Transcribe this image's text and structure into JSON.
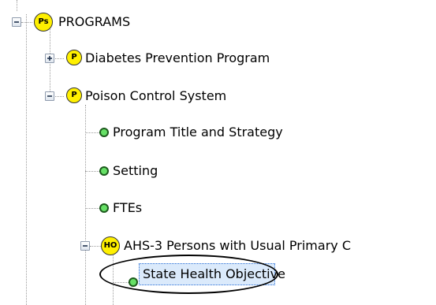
{
  "tree": {
    "nodes": [
      {
        "id": "programs",
        "label": "PROGRAMS",
        "badge": "Ps",
        "toggle": "collapse"
      },
      {
        "id": "diabetes-prevention-program",
        "label": "Diabetes Prevention Program",
        "badge": "P",
        "toggle": "expand"
      },
      {
        "id": "poison-control-system",
        "label": "Poison Control System",
        "badge": "P",
        "toggle": "collapse"
      },
      {
        "id": "program-title-and-strategy",
        "label": "Program Title and Strategy",
        "icon": "green-circle-icon"
      },
      {
        "id": "setting",
        "label": "Setting",
        "icon": "green-circle-icon"
      },
      {
        "id": "ftes",
        "label": "FTEs",
        "icon": "green-circle-icon"
      },
      {
        "id": "ahs-3",
        "label": "AHS-3 Persons with Usual Primary C",
        "badge": "HO",
        "toggle": "collapse"
      },
      {
        "id": "state-health-objective",
        "label": "State Health Objective",
        "icon": "green-circle-icon",
        "selected": true,
        "highlight": "black-oval"
      }
    ]
  },
  "colors": {
    "badge_fill": "#fff000",
    "leaf_dot": "#66e066",
    "selection": "#dbeafb",
    "tree_line": "#9c9c9c",
    "oval": "#000000"
  }
}
